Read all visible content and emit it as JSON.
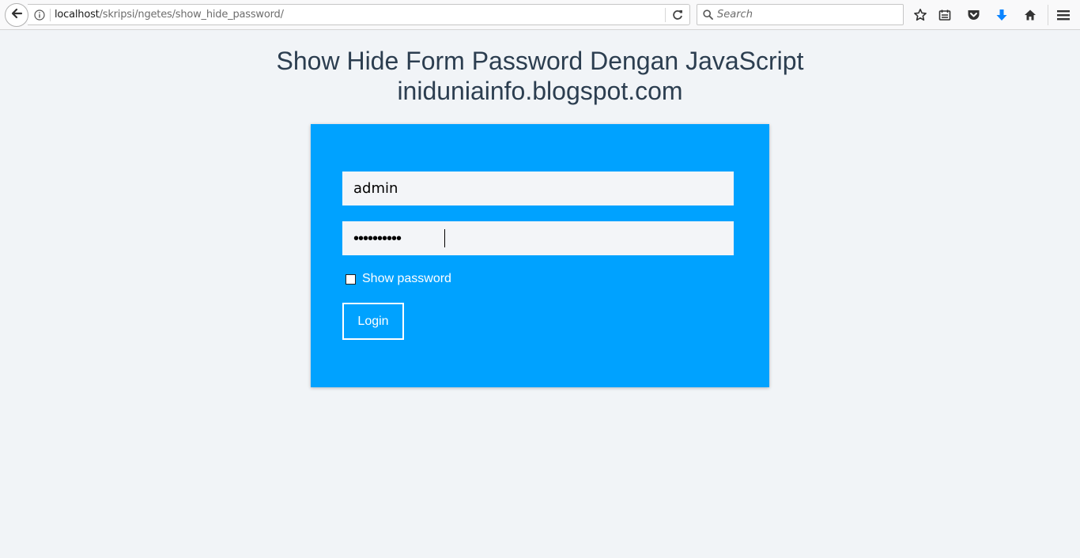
{
  "browser": {
    "url_host": "localhost",
    "url_path": "/skripsi/ngetes/show_hide_password/",
    "search_placeholder": "Search",
    "icons": [
      "back-icon",
      "info-icon",
      "reload-icon",
      "search-icon",
      "bookmark-star-icon",
      "reader-list-icon",
      "pocket-icon",
      "download-icon",
      "home-icon",
      "menu-icon"
    ],
    "download_color": "#0a84ff"
  },
  "page": {
    "title_line1": "Show Hide Form Password Dengan JavaScript",
    "title_line2": "iniduniainfo.blogspot.com"
  },
  "form": {
    "username_value": "admin",
    "password_masked": "••••••••••",
    "show_password_label": "Show password",
    "show_password_checked": false,
    "login_label": "Login",
    "card_color": "#00a2ff"
  }
}
